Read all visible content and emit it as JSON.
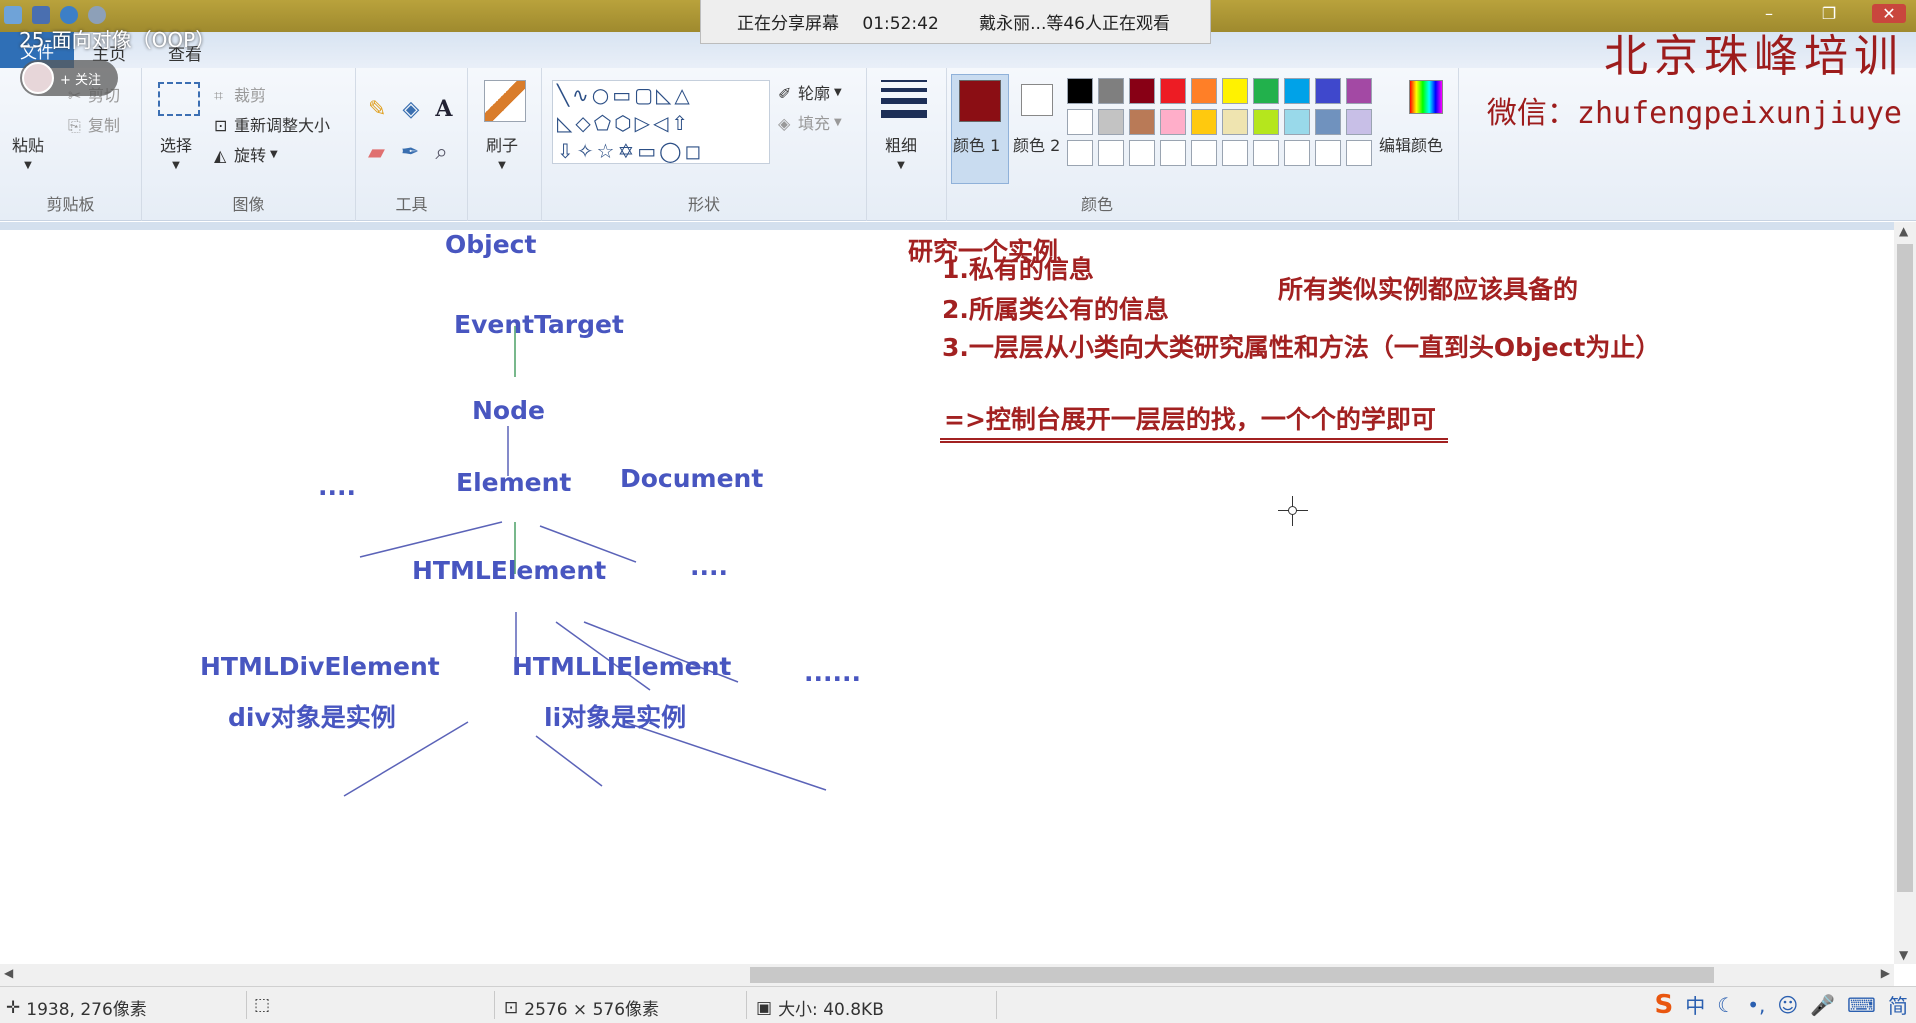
{
  "window": {
    "title": "25-面向对像（OOP）",
    "controls": [
      "–",
      "❐",
      "✕"
    ]
  },
  "share_banner": {
    "status": "正在分享屏幕",
    "time": "01:52:42",
    "viewers": "戴永丽...等46人正在观看"
  },
  "follow": {
    "label": "+ 关注"
  },
  "tabs": {
    "file": "文件",
    "home": "主页",
    "view": "查看"
  },
  "ribbon": {
    "clipboard": {
      "paste": "粘贴",
      "cut": "剪切",
      "copy": "复制",
      "group": "剪贴板"
    },
    "image": {
      "select": "选择",
      "crop": "裁剪",
      "resize": "重新调整大小",
      "rotate": "旋转",
      "group": "图像"
    },
    "tools": {
      "group": "工具"
    },
    "brush": {
      "label": "刷子"
    },
    "shapes": {
      "outline": "轮廓",
      "fill": "填充",
      "group": "形状"
    },
    "size": {
      "label": "粗细"
    },
    "colors": {
      "color1": "颜色 1",
      "color2": "颜色 2",
      "edit": "编辑颜色",
      "group": "颜色",
      "color1_value": "#8b0e14",
      "palette_row1": [
        "#000000",
        "#7f7f7f",
        "#880015",
        "#ed1c24",
        "#ff7f27",
        "#fff200",
        "#22b14c",
        "#00a2e8",
        "#3f48cc",
        "#a349a4"
      ],
      "palette_row2": [
        "#ffffff",
        "#c3c3c3",
        "#b97a57",
        "#ffaec9",
        "#ffc90e",
        "#efe4b0",
        "#b5e61d",
        "#99d9ea",
        "#7092be",
        "#c8bfe7"
      ]
    }
  },
  "brand": {
    "name": "北京珠峰培训",
    "wechat": "微信：zhufengpeixunjiuye"
  },
  "diagram": {
    "object": "Object",
    "event_target": "EventTarget",
    "node": "Node",
    "dots_left": "....",
    "element": "Element",
    "document": "Document",
    "html_element": "HTMLElement",
    "dots_mid": "....",
    "html_div": "HTMLDivElement",
    "html_li": "HTMLLIElement",
    "dots_right": "......",
    "div_note": "div对象是实例",
    "li_note": "li对象是实例"
  },
  "notes": {
    "title": "研究一个实例",
    "item1": "1.私有的信息",
    "item2": "2.所属类公有的信息",
    "item2_side": "所有类似实例都应该具备的",
    "item3": "3.一层层从小类向大类研究属性和方法（一直到头Object为止）",
    "conclusion": "=>控制台展开一层层的找，一个个的学即可"
  },
  "status": {
    "cursor": "1938, 276像素",
    "dimensions": "2576 × 576像素",
    "size": "大小: 40.8KB"
  },
  "ime": [
    "中",
    "☾",
    "•,",
    "☺",
    "🎤",
    "⌨",
    "简"
  ]
}
